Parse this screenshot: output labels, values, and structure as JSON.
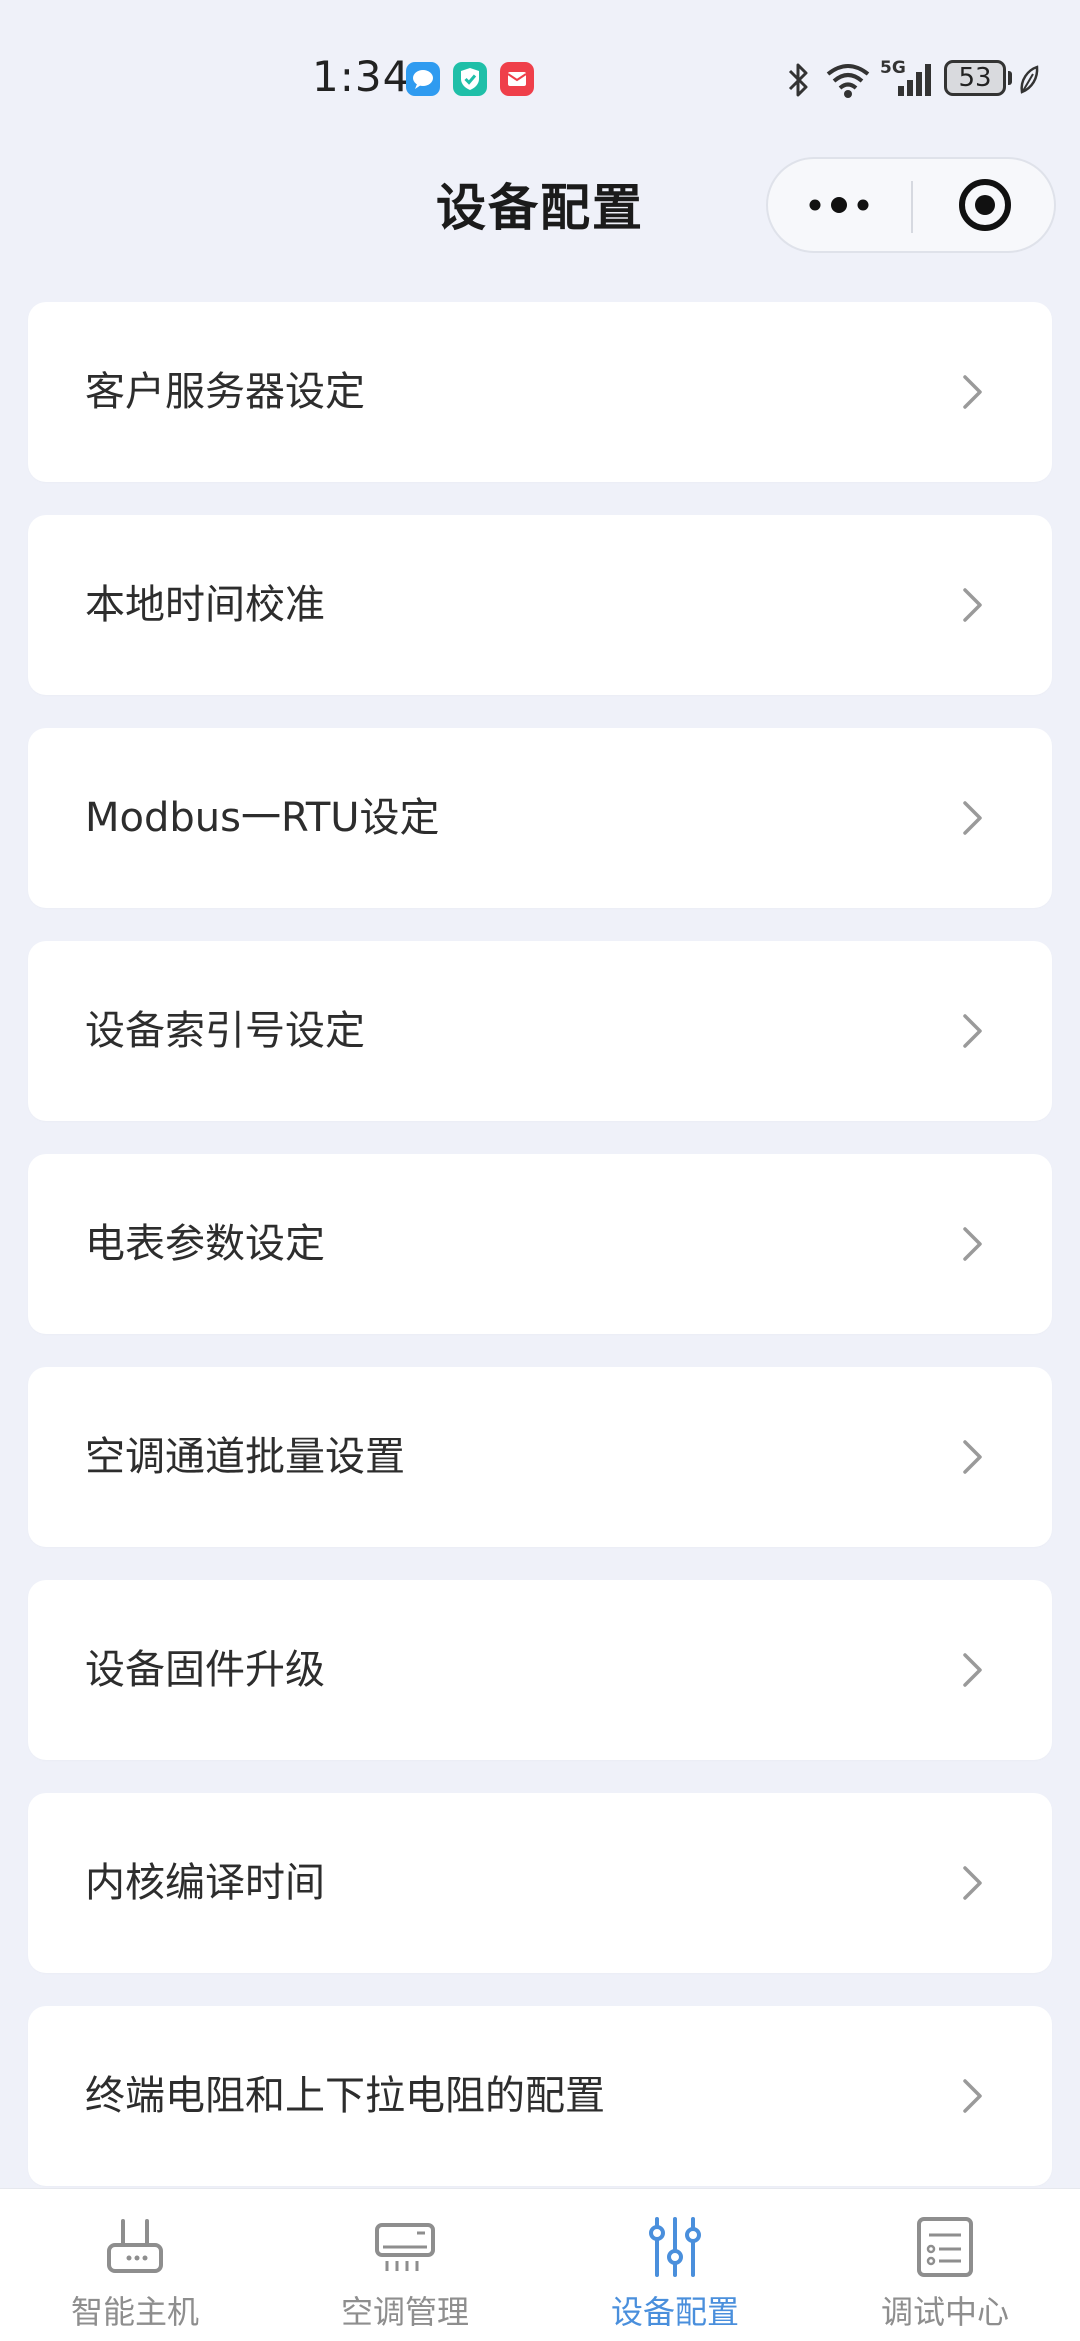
{
  "status_bar": {
    "time": "1:34",
    "battery": "53",
    "network": "5G",
    "notifications": [
      "chat-notification-icon",
      "shield-notification-icon",
      "mail-notification-icon"
    ]
  },
  "nav": {
    "title": "设备配置",
    "more_icon": "more-dots-icon",
    "close_icon": "target-close-icon"
  },
  "menu": {
    "items": [
      {
        "label": "客户服务器设定"
      },
      {
        "label": "本地时间校准"
      },
      {
        "label": "Modbus一RTU设定"
      },
      {
        "label": "设备索引号设定"
      },
      {
        "label": "电表参数设定"
      },
      {
        "label": "空调通道批量设置"
      },
      {
        "label": "设备固件升级"
      },
      {
        "label": "内核编译时间"
      },
      {
        "label": "终端电阻和上下拉电阻的配置"
      }
    ]
  },
  "tabbar": {
    "tabs": [
      {
        "label": "智能主机",
        "icon": "router-icon"
      },
      {
        "label": "空调管理",
        "icon": "air-conditioner-icon"
      },
      {
        "label": "设备配置",
        "icon": "sliders-icon",
        "active": true
      },
      {
        "label": "调试中心",
        "icon": "checklist-icon"
      }
    ],
    "active_color": "#4a8fdc",
    "inactive_color": "#8e8e8e"
  }
}
